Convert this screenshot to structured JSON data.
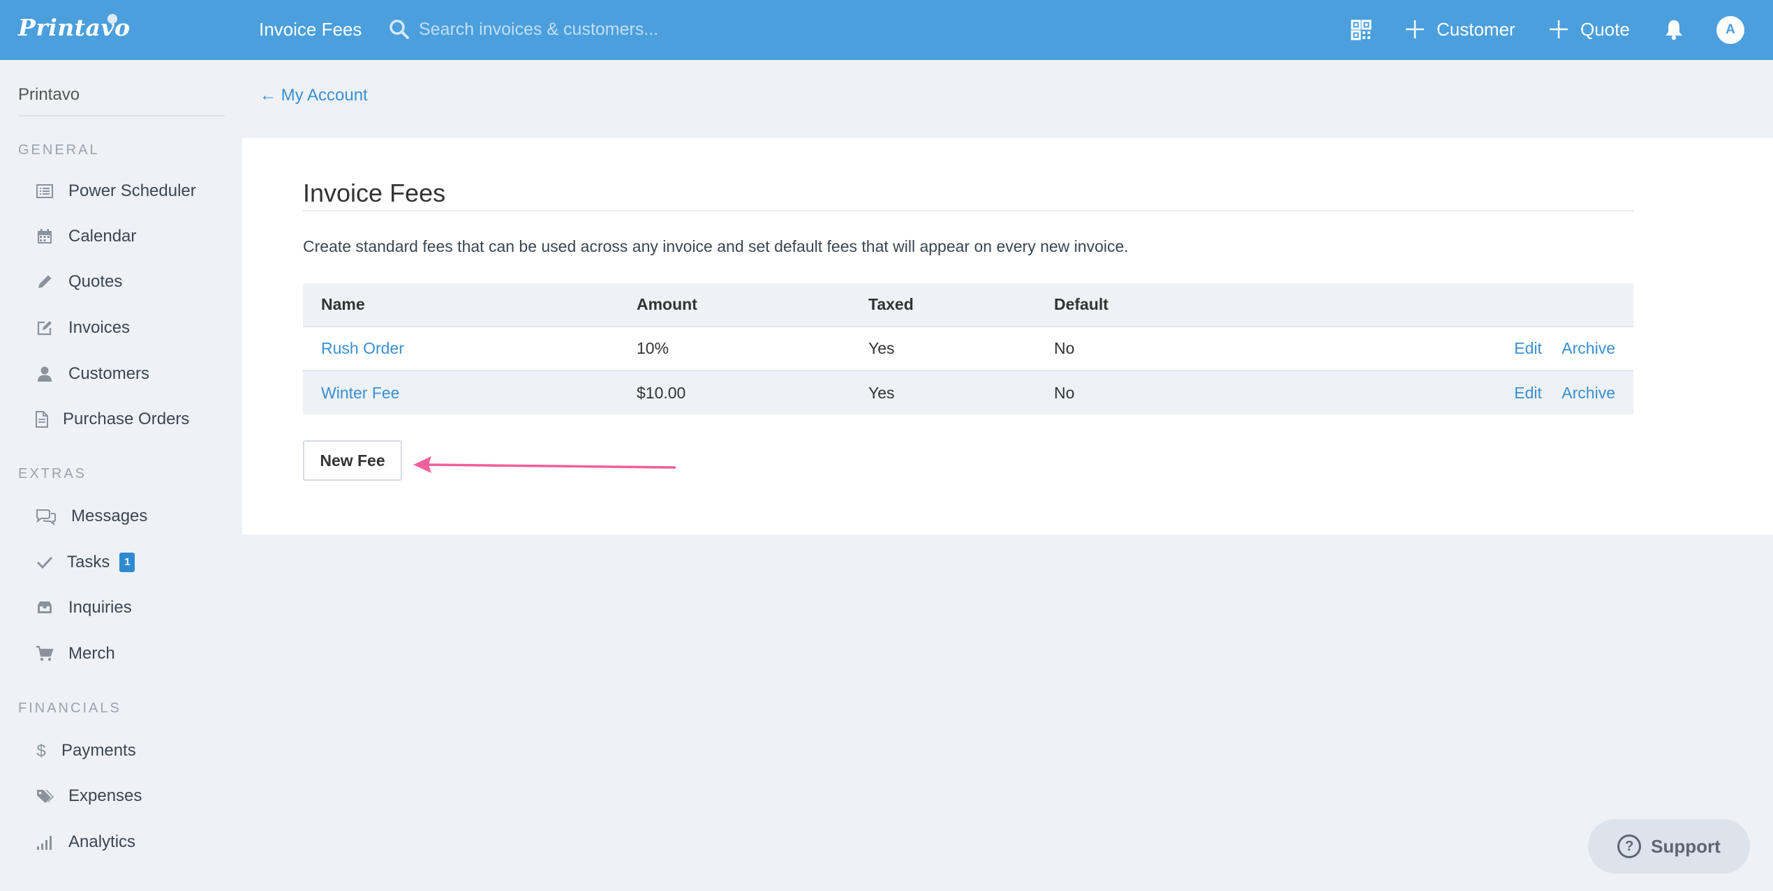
{
  "topbar": {
    "logo": "Printavo",
    "page_name": "Invoice Fees",
    "search_placeholder": "Search invoices & customers...",
    "add_customer_label": "Customer",
    "add_quote_label": "Quote",
    "avatar_initial": "A"
  },
  "sidebar": {
    "brand": "Printavo",
    "sections": {
      "general": "GENERAL",
      "extras": "EXTRAS",
      "financials": "FINANCIALS"
    },
    "general_items": [
      {
        "label": "Power Scheduler",
        "icon": "list-icon"
      },
      {
        "label": "Calendar",
        "icon": "calendar-icon"
      },
      {
        "label": "Quotes",
        "icon": "pencil-icon"
      },
      {
        "label": "Invoices",
        "icon": "edit-icon"
      },
      {
        "label": "Customers",
        "icon": "user-icon"
      },
      {
        "label": "Purchase Orders",
        "icon": "document-icon"
      }
    ],
    "extras_items": [
      {
        "label": "Messages",
        "icon": "chat-icon"
      },
      {
        "label": "Tasks",
        "icon": "check-icon",
        "badge": "1"
      },
      {
        "label": "Inquiries",
        "icon": "inbox-icon"
      },
      {
        "label": "Merch",
        "icon": "cart-icon"
      }
    ],
    "financials_items": [
      {
        "label": "Payments",
        "icon": "dollar-icon"
      },
      {
        "label": "Expenses",
        "icon": "tag-icon"
      },
      {
        "label": "Analytics",
        "icon": "signal-icon"
      }
    ]
  },
  "main": {
    "back_link": "← My Account",
    "title": "Invoice Fees",
    "description": "Create standard fees that can be used across any invoice and set default fees that will appear on every new invoice.",
    "table": {
      "headers": [
        "Name",
        "Amount",
        "Taxed",
        "Default"
      ],
      "rows": [
        {
          "name": "Rush Order",
          "amount": "10%",
          "taxed": "Yes",
          "default": "No",
          "edit": "Edit",
          "archive": "Archive"
        },
        {
          "name": "Winter Fee",
          "amount": "$10.00",
          "taxed": "Yes",
          "default": "No",
          "edit": "Edit",
          "archive": "Archive"
        }
      ]
    },
    "new_fee_label": "New Fee"
  },
  "support_label": "Support",
  "colors": {
    "topbar": "#4a9fdc",
    "link": "#3a8fd0",
    "badge": "#2e8ad1",
    "annotation_arrow": "#f0609b",
    "background": "#eef2f7"
  }
}
